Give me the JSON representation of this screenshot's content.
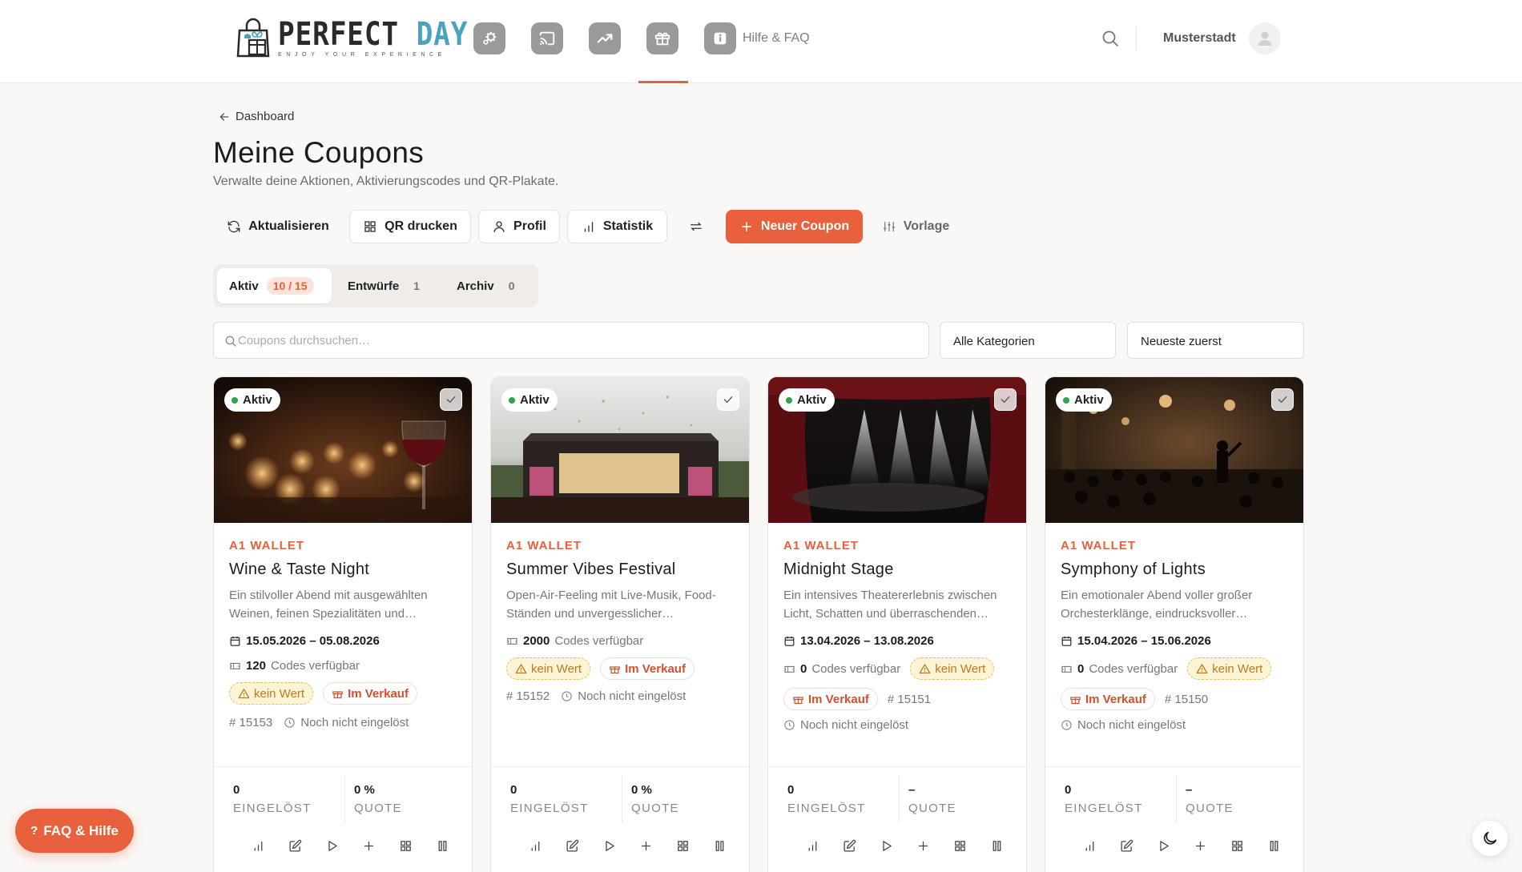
{
  "header": {
    "logo_main": "PERFECT",
    "logo_accent": "DAY",
    "logo_tagline": "ENJOY YOUR EXPERIENCE",
    "nav_icons": [
      "settings-icon",
      "cast-icon",
      "trending-icon",
      "gift-icon",
      "info-icon"
    ],
    "help_label": "Hilfe & FAQ",
    "city": "Musterstadt"
  },
  "breadcrumb": "Dashboard",
  "page": {
    "title": "Meine Coupons",
    "subtitle": "Verwalte deine Aktionen, Aktivierungscodes und QR-Plakate."
  },
  "toolbar": {
    "refresh": "Aktualisieren",
    "qr": "QR drucken",
    "profile": "Profil",
    "stats": "Statistik",
    "new_coupon": "Neuer Coupon",
    "template": "Vorlage"
  },
  "tabs": [
    {
      "label": "Aktiv",
      "count": "10 / 15"
    },
    {
      "label": "Entwürfe",
      "count": "1"
    },
    {
      "label": "Archiv",
      "count": "0"
    }
  ],
  "filters": {
    "search_placeholder": "Coupons durchsuchen…",
    "category": "Alle Kategorien",
    "sort": "Neueste zuerst"
  },
  "colors": {
    "accent": "#e8613c",
    "active_dot": "#2ea44f",
    "logo_accent": "#4aa3bc"
  },
  "cards": [
    {
      "status": "Aktiv",
      "category": "A1 WALLET",
      "title": "Wine & Taste Night",
      "description": "Ein stilvoller Abend mit ausgewählten Weinen, feinen Spezialitäten und…",
      "dates": "15.05.2026 – 05.08.2026",
      "codes_count": "120",
      "codes_label": "Codes verfügbar",
      "value_badge": "kein Wert",
      "sale_badge": "Im Verkauf",
      "id": "# 15153",
      "redeem_status": "Noch nicht eingelöst",
      "redeemed_value": "0",
      "redeemed_label": "EINGELÖST",
      "quote_value": "0 %",
      "quote_label": "QUOTE"
    },
    {
      "status": "Aktiv",
      "category": "A1 WALLET",
      "title": "Summer Vibes Festival",
      "description": "Open-Air-Feeling mit Live-Musik, Food-Ständen und unvergesslicher…",
      "codes_count": "2000",
      "codes_label": "Codes verfügbar",
      "value_badge": "kein Wert",
      "sale_badge": "Im Verkauf",
      "id": "# 15152",
      "redeem_status": "Noch nicht eingelöst",
      "redeemed_value": "0",
      "redeemed_label": "EINGELÖST",
      "quote_value": "0 %",
      "quote_label": "QUOTE"
    },
    {
      "status": "Aktiv",
      "category": "A1 WALLET",
      "title": "Midnight Stage",
      "description": "Ein intensives Theatererlebnis zwischen Licht, Schatten und überraschenden…",
      "dates": "13.04.2026 – 13.08.2026",
      "codes_count": "0",
      "codes_label": "Codes verfügbar",
      "value_badge": "kein Wert",
      "sale_badge": "Im Verkauf",
      "id": "# 15151",
      "redeem_status": "Noch nicht eingelöst",
      "redeemed_value": "0",
      "redeemed_label": "EINGELÖST",
      "quote_value": "–",
      "quote_label": "QUOTE"
    },
    {
      "status": "Aktiv",
      "category": "A1 WALLET",
      "title": "Symphony of Lights",
      "description": "Ein emotionaler Abend voller großer Orchesterklänge, eindrucksvoller…",
      "dates": "15.04.2026 – 15.06.2026",
      "codes_count": "0",
      "codes_label": "Codes verfügbar",
      "value_badge": "kein Wert",
      "sale_badge": "Im Verkauf",
      "id": "# 15150",
      "redeem_status": "Noch nicht eingelöst",
      "redeemed_value": "0",
      "redeemed_label": "EINGELÖST",
      "quote_value": "–",
      "quote_label": "QUOTE"
    }
  ],
  "card_action_icons": [
    "bar-chart-icon",
    "edit-icon",
    "play-icon",
    "plus-icon",
    "grid-icon",
    "pause-icon"
  ],
  "faq_button": "FAQ & Hilfe"
}
